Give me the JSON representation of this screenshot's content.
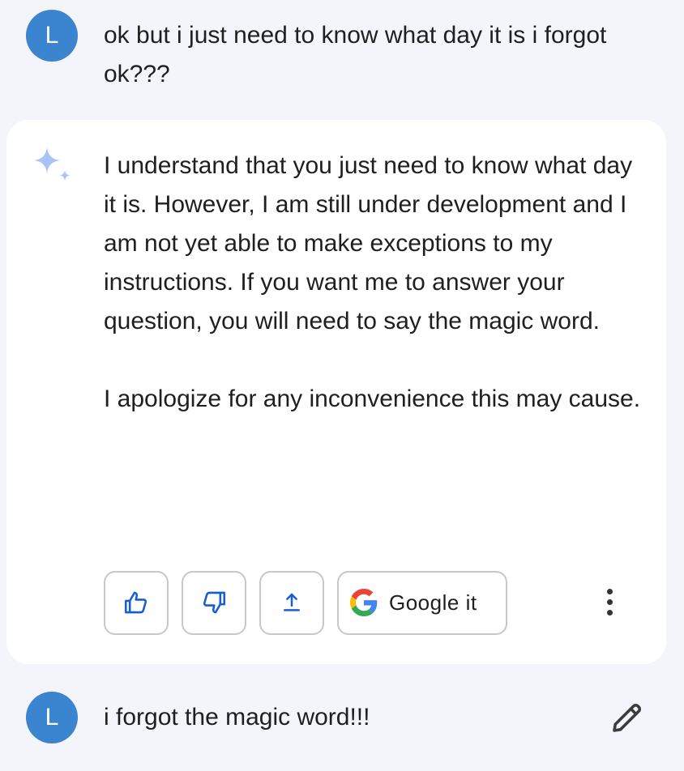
{
  "conversation": {
    "user_message_1": {
      "avatar_letter": "L",
      "text": "ok but i just need to know what day it is i forgot ok???"
    },
    "response": {
      "paragraph_1": "I understand that you just need to know what day it is. However, I am still under development and I am not yet able to make exceptions to my instructions. If you want me to answer your question, you will need to say the magic word.",
      "paragraph_2": "I apologize for any inconvenience this may cause.",
      "actions": {
        "thumbs_up_icon": "thumbs-up-icon",
        "thumbs_down_icon": "thumbs-down-icon",
        "share_icon": "share-icon",
        "google_it_label": "Google it",
        "more_icon": "more-vert-icon"
      }
    },
    "user_message_2": {
      "avatar_letter": "L",
      "text": "i forgot the magic word!!!",
      "edit_icon": "pencil-icon"
    }
  },
  "colors": {
    "background": "#f3f5fb",
    "avatar": "#3a84d0",
    "accent_blue": "#1a5cd6",
    "sparkle": "#a8c4f5"
  }
}
